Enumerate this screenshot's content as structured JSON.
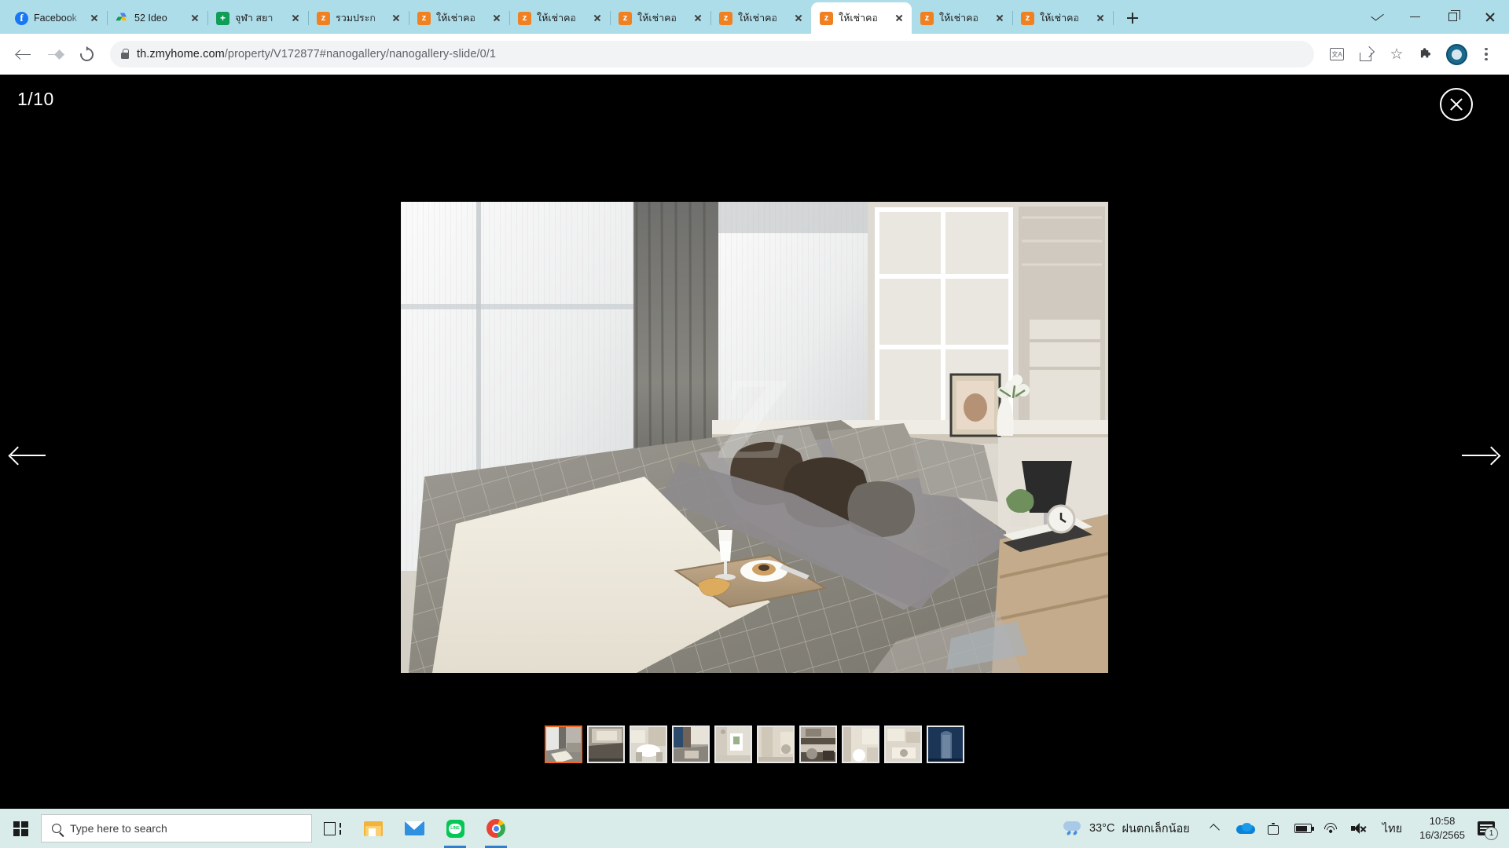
{
  "browser": {
    "tabs": [
      {
        "title": "Facebook",
        "favicon": "facebook-icon",
        "active": false
      },
      {
        "title": "52 Ideo",
        "favicon": "google-drive-icon",
        "active": false
      },
      {
        "title": "จุฬา สยา",
        "favicon": "google-sheets-icon",
        "active": false
      },
      {
        "title": "รวมประก",
        "favicon": "zmyhome-icon",
        "active": false
      },
      {
        "title": "ให้เช่าคอ",
        "favicon": "zmyhome-icon",
        "active": false
      },
      {
        "title": "ให้เช่าคอ",
        "favicon": "zmyhome-icon",
        "active": false
      },
      {
        "title": "ให้เช่าคอ",
        "favicon": "zmyhome-icon",
        "active": false
      },
      {
        "title": "ให้เช่าคอ",
        "favicon": "zmyhome-icon",
        "active": false
      },
      {
        "title": "ให้เช่าคอ",
        "favicon": "zmyhome-icon",
        "active": true
      },
      {
        "title": "ให้เช่าคอ",
        "favicon": "zmyhome-icon",
        "active": false
      },
      {
        "title": "ให้เช่าคอ",
        "favicon": "zmyhome-icon",
        "active": false
      }
    ],
    "new_tab_label": "+",
    "window_controls": {
      "dropdown": "chevron-down-icon",
      "minimize": "minimize-icon",
      "maximize": "restore-icon",
      "close": "close-icon"
    },
    "toolbar": {
      "back": "back-arrow-icon",
      "forward": "forward-arrow-icon",
      "reload": "reload-icon",
      "lock": "lock-icon",
      "url_domain": "th.zmyhome.com",
      "url_path": "/property/V172877#nanogallery/nanogallery-slide/0/1",
      "translate": "translate-icon",
      "translate_glyph": "文A",
      "share": "share-icon",
      "bookmark": "star-icon",
      "bookmark_glyph": "☆",
      "extensions": "puzzle-icon",
      "extensions_glyph": "🧩",
      "profile": "avatar-icon",
      "menu": "three-dot-menu-icon"
    }
  },
  "lightbox": {
    "counter": "1/10",
    "close": "close-circle-icon",
    "prev": "prev-arrow-icon",
    "next": "next-arrow-icon",
    "watermark": "Z",
    "main_image_alt": "bedroom-interior-photo",
    "thumbnails": [
      {
        "alt": "bedroom-thumbnail-1",
        "selected": true
      },
      {
        "alt": "bedroom-thumbnail-2",
        "selected": false
      },
      {
        "alt": "living-room-thumbnail-3",
        "selected": false
      },
      {
        "alt": "bedroom-thumbnail-4",
        "selected": false
      },
      {
        "alt": "bathroom-thumbnail-5",
        "selected": false
      },
      {
        "alt": "hallway-thumbnail-6",
        "selected": false
      },
      {
        "alt": "kitchen-thumbnail-7",
        "selected": false
      },
      {
        "alt": "bathroom-thumbnail-8",
        "selected": false
      },
      {
        "alt": "kitchen-thumbnail-9",
        "selected": false
      },
      {
        "alt": "building-exterior-thumbnail-10",
        "selected": false
      }
    ],
    "selected_border_color": "#f26722"
  },
  "taskbar": {
    "start": "windows-start-icon",
    "search_placeholder": "Type here to search",
    "search_icon": "search-icon",
    "task_view": "task-view-icon",
    "apps": [
      {
        "name": "file-explorer-icon",
        "running": false
      },
      {
        "name": "mail-icon",
        "running": false
      },
      {
        "name": "line-icon",
        "running": true
      },
      {
        "name": "chrome-icon",
        "running": true
      }
    ],
    "tray": {
      "weather_icon": "rain-cloud-icon",
      "temperature": "33°C",
      "weather_text": "ฝนตกเล็กน้อย",
      "show_hidden": "chevron-up-icon",
      "onedrive": "onedrive-icon",
      "meet": "camera-icon",
      "battery": "battery-icon",
      "wifi": "wifi-icon",
      "volume": "volume-muted-icon",
      "language": "ไทย",
      "time": "10:58",
      "date": "16/3/2565",
      "notification": "notification-icon",
      "notification_count": "1"
    }
  }
}
